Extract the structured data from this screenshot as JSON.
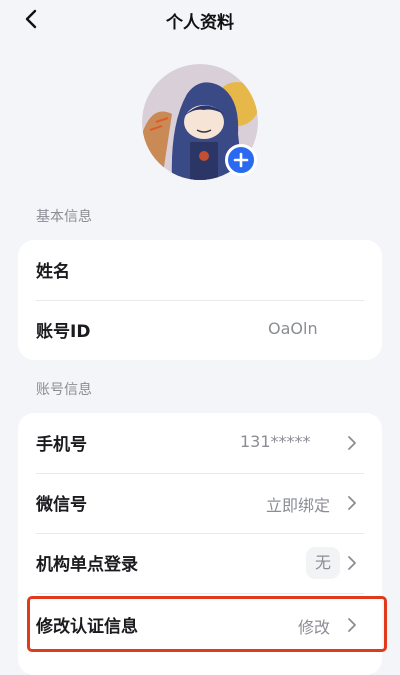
{
  "header": {
    "title": "个人资料"
  },
  "sections": {
    "basic": {
      "label": "基本信息",
      "name_label": "姓名",
      "account_id_label": "账号ID",
      "account_id_value": "OaOln"
    },
    "account": {
      "label": "账号信息",
      "phone_label": "手机号",
      "phone_value": "131*****",
      "wechat_label": "微信号",
      "wechat_value": "立即绑定",
      "sso_label": "机构单点登录",
      "sso_value": "无",
      "cert_label": "修改认证信息",
      "cert_value": "修改"
    }
  },
  "colors": {
    "accent": "#2a6af0",
    "highlight": "#e03a1e",
    "background": "#f4f5f8"
  },
  "icons": [
    "chevron-left-icon",
    "plus-icon",
    "chevron-right-icon"
  ]
}
